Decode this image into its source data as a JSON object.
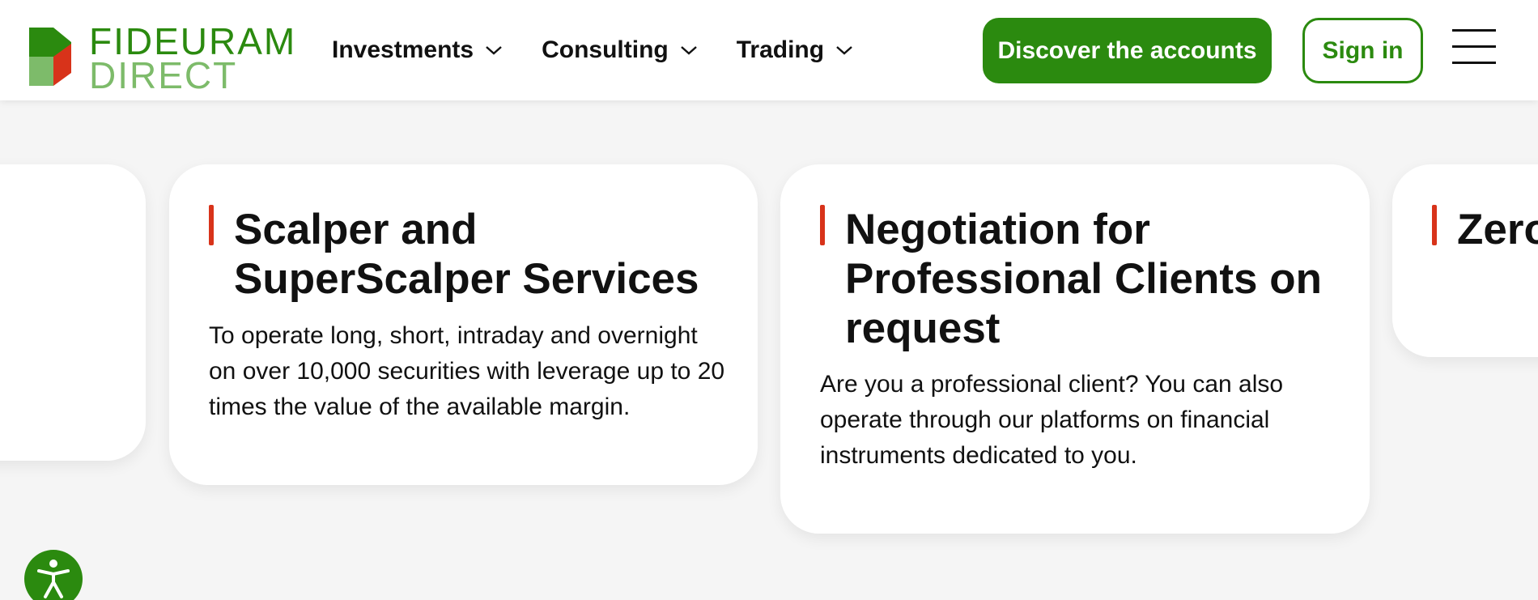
{
  "brand": {
    "line1": "FIDEURAM",
    "line2": "DIRECT",
    "colors": {
      "green": "#2b8a0f",
      "light_green": "#7dbb6a",
      "red": "#d8331a"
    }
  },
  "nav": {
    "items": [
      {
        "label": "Investments"
      },
      {
        "label": "Consulting"
      },
      {
        "label": "Trading"
      }
    ]
  },
  "header": {
    "primary_button": "Discover the accounts",
    "secondary_button": "Sign in"
  },
  "cards": [
    {
      "title": "Scalper and SuperScalper Services",
      "description": "To operate long, short, intraday and overnight on over 10,000 securities with leverage up to 20 times the value of the available margin."
    },
    {
      "title": "Negotiation for Professional Clients on request",
      "description": "Are you a professional client? You can also operate through our platforms on financial instruments dedicated to you."
    },
    {
      "title": "Zero account"
    }
  ],
  "icons": {
    "logo": "fideuram-logo-mark",
    "chevron": "chevron-down-icon",
    "menu": "hamburger-menu-icon",
    "accessibility": "accessibility-icon"
  }
}
